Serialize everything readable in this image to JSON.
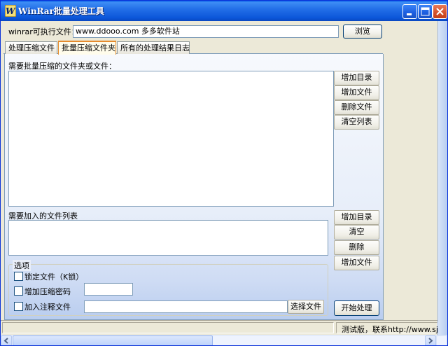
{
  "window": {
    "title": "WinRar批量处理工具",
    "icon": "winrar-app-icon"
  },
  "titlebar_buttons": {
    "minimize_icon": "minimize-icon",
    "maximize_icon": "maximize-icon",
    "close_icon": "close-icon"
  },
  "exe_row": {
    "label": "winrar可执行文件：",
    "value": "www.ddooo.com 多多软件站",
    "browse_label": "浏览"
  },
  "tabs": [
    {
      "label": "处理压缩文件",
      "active": false
    },
    {
      "label": "批量压缩文件夹",
      "active": true
    },
    {
      "label": "所有的处理结果日志",
      "active": false
    }
  ],
  "folders_section": {
    "label": "需要批量压缩的文件夹或文件：",
    "buttons": [
      "增加目录",
      "增加文件",
      "删除文件",
      "清空列表"
    ]
  },
  "addfiles_section": {
    "label": "需要加入的文件列表",
    "buttons": [
      "增加目录",
      "清空",
      "删除",
      "增加文件"
    ]
  },
  "options": {
    "legend": "选项",
    "lock_label": "锁定文件（K锁）",
    "password_label": "增加压缩密码",
    "password_value": "",
    "comment_label": "加入注释文件",
    "comment_value": "",
    "select_file_label": "选择文件"
  },
  "start_label": "开始处理",
  "status": {
    "text": "测试版，联系http://www.sjcoder.com"
  },
  "colors": {
    "titlebar": "#0b56d9",
    "tab_accent": "#e68b2c",
    "panel_gradient_bottom": "#b9cdef"
  }
}
